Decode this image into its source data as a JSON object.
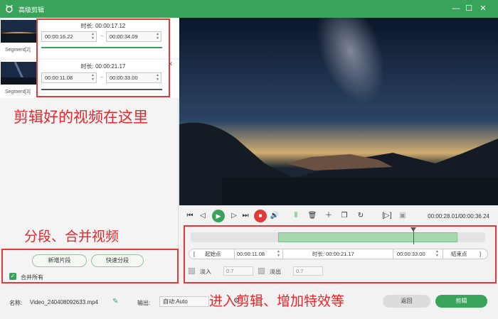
{
  "window": {
    "title": "高级剪辑"
  },
  "segments": [
    {
      "label": "Segment[2]",
      "duration": "时长:  00:00:17.12",
      "start": "00:00:16.22",
      "end": "00:00:34.09"
    },
    {
      "label": "Segment[3]",
      "duration": "时长:  00:00:21.17",
      "start": "00:00:11.08",
      "end": "00:00:33.00"
    }
  ],
  "left_buttons": {
    "new_segment": "新增片段",
    "quick_split": "快速分段",
    "merge_all": "合并所有"
  },
  "annotations": {
    "clips_here": "剪辑好的视频在这里",
    "split_merge": "分段、合并视频",
    "enter_edit": "进入剪辑、增加特效等"
  },
  "player": {
    "time": "00:00:28.01/00:00:36.24"
  },
  "editor": {
    "start_bracket": "[",
    "start_label": "起始点",
    "start_value": "00:00:11.08",
    "duration": "时长:  00:00:21.17",
    "end_value": "00:00:33.00",
    "end_label": "结束点",
    "end_bracket": "]",
    "fade_in_label": "淡入",
    "fade_in_value": "0.7",
    "fade_out_label": "淡出",
    "fade_out_value": "0.7"
  },
  "bottom": {
    "name_label": "名称:",
    "filename": "Video_240408092633.mp4",
    "output_label": "输出:",
    "output_value": "自动:Auto",
    "back": "返回",
    "cut": "剪辑"
  },
  "colors": {
    "accent": "#3aa35b",
    "annotation": "#e8262b"
  }
}
